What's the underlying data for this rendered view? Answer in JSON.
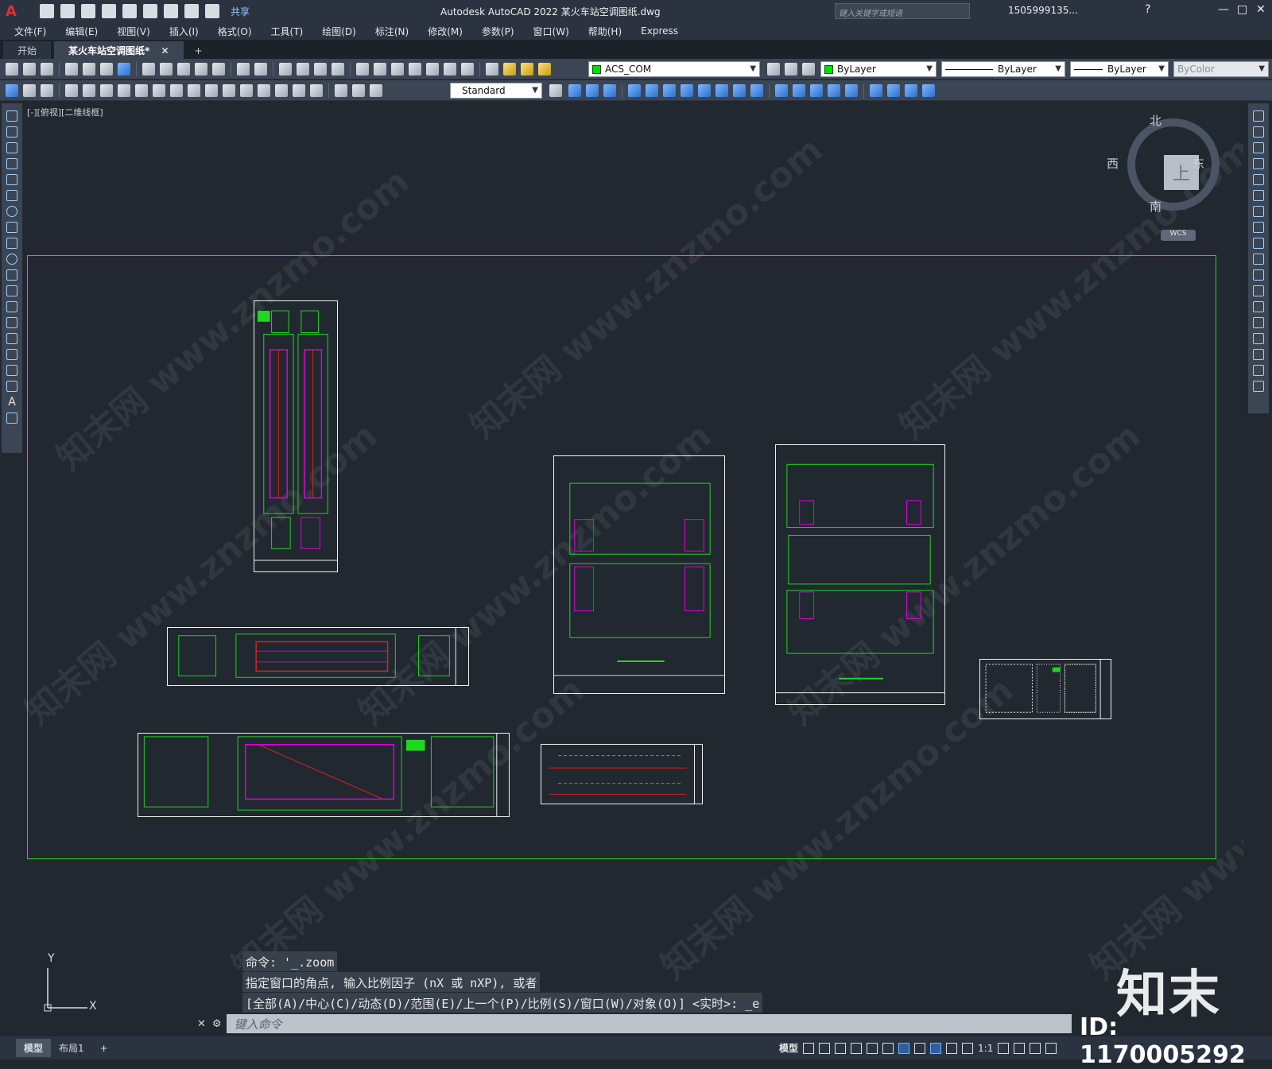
{
  "titlebar": {
    "app_logo": "A",
    "share": "共享",
    "title": "Autodesk AutoCAD 2022    某火车站空调图纸.dwg",
    "search_placeholder": "键入关键字或短语",
    "user": "1505999135...",
    "help": "?"
  },
  "menu": [
    "文件(F)",
    "编辑(E)",
    "视图(V)",
    "插入(I)",
    "格式(O)",
    "工具(T)",
    "绘图(D)",
    "标注(N)",
    "修改(M)",
    "参数(P)",
    "窗口(W)",
    "帮助(H)",
    "Express"
  ],
  "tabs": [
    {
      "label": "开始"
    },
    {
      "label": "某火车站空调图纸*"
    }
  ],
  "tab_close": "✕",
  "tab_add": "+",
  "toolbar": {
    "layer": "ACS_COM",
    "color": "ByLayer",
    "linetype": "ByLayer",
    "lineweight": "ByLayer",
    "plotstyle": "ByColor",
    "text_style": "Standard"
  },
  "viewport": {
    "label": "[-][俯视][二维线框]",
    "cube_face": "上",
    "north": "北",
    "south": "南",
    "east": "东",
    "west": "西",
    "wcs": "WCS"
  },
  "watermark": "知末网 www.znzmo.com",
  "command": {
    "history": [
      "命令: '_.zoom",
      "指定窗口的角点, 输入比例因子 (nX 或 nXP), 或者",
      "[全部(A)/中心(C)/动态(D)/范围(E)/上一个(P)/比例(S)/窗口(W)/对象(O)] <实时>: _e"
    ],
    "placeholder": "键入命令"
  },
  "ucs": {
    "x": "X",
    "y": "Y"
  },
  "layout_tabs": [
    {
      "label": "模型"
    },
    {
      "label": "布局1"
    }
  ],
  "layout_add": "+",
  "status": {
    "model": "模型",
    "scale": "1:1"
  },
  "brand": {
    "logo": "知末",
    "id": "ID: 1170005292"
  },
  "colors": {
    "frame_green": "#1fd71f",
    "accent_magenta": "#e000e0",
    "accent_red": "#e02020",
    "background": "#212830"
  }
}
